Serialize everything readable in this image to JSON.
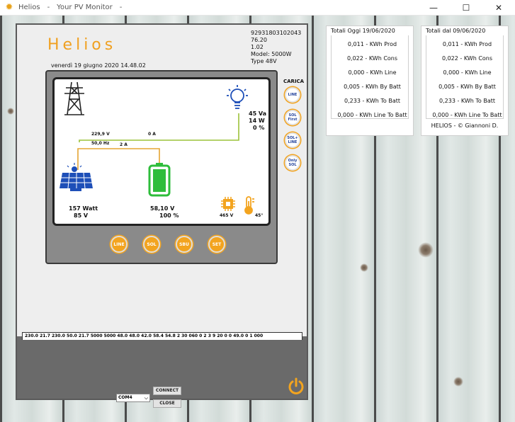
{
  "window": {
    "app_name": "Helios",
    "separator": "-",
    "subtitle": "Your PV Monitor",
    "dash": "-",
    "minimize": "—",
    "maximize": "☐",
    "close": "✕"
  },
  "device": {
    "logo": "Helios",
    "serial": "92931803102043",
    "firmware": "76.20",
    "version": "1.02",
    "model": "Model: 5000W",
    "type": "Type 48V",
    "datetime": "venerdì 19 giugno 2020 14.48.02",
    "charge_label": "CARICA",
    "charge_modes": [
      "LINE",
      "SOL First",
      "SOL+ LINE",
      "Only SOL"
    ],
    "nav_buttons": [
      "LINE",
      "SOL",
      "SBU",
      "SET"
    ],
    "grid_voltage": "229,9 V",
    "grid_frequency": "50,0 Hz",
    "grid_current": "0 A",
    "battery_current": "2 A",
    "load_power_va": "45 Va",
    "load_power_w": "14 W",
    "load_percent": "0 %",
    "pv_power": "157 Watt",
    "pv_voltage": "85 V",
    "battery_voltage": "58,10 V",
    "battery_percent": "100 %",
    "inverter_voltage": "465 V",
    "temperature": "45°",
    "raw_data": "230.0 21.7 230.0 50.0 21.7 5000 5000 48.0 48.0 42.0 58.4 54.8 2 30 060 0 2 3 9 20 0 0 49.0 0 1 000",
    "com_port": "COM4",
    "connect_label": "CONNECT",
    "close_label": "CLOSE"
  },
  "totals_today": {
    "title": "Totali Oggi 19/06/2020",
    "rows": [
      "0,011 - KWh Prod",
      "0,022 - KWh Cons",
      "0,000 - KWh  Line",
      "0,005 - KWh By Batt",
      "0,233 - KWh To Batt",
      "0,000 - KWh Line To Batt"
    ]
  },
  "totals_since": {
    "title": "Totali dal 09/06/2020",
    "rows": [
      "0,011 - KWh Prod",
      "0,022 - KWh Cons",
      "0,000 - KWh  Line",
      "0,005 - KWh By Batt",
      "0,233 - KWh To Batt",
      "0,000 - KWh Line To Batt"
    ],
    "credit": "HELIOS - © Giannoni D."
  },
  "colors": {
    "accent": "#f3a41f",
    "line_green": "#9cc23a",
    "line_orange": "#e5a533",
    "battery_green": "#2ebd3b",
    "pv_blue": "#1e4fb8"
  },
  "icons": [
    "sun-gear-icon",
    "pylon-icon",
    "bulb-icon",
    "solar-panel-icon",
    "battery-icon",
    "chip-icon",
    "thermometer-icon",
    "power-icon",
    "dropdown-arrow-icon"
  ]
}
